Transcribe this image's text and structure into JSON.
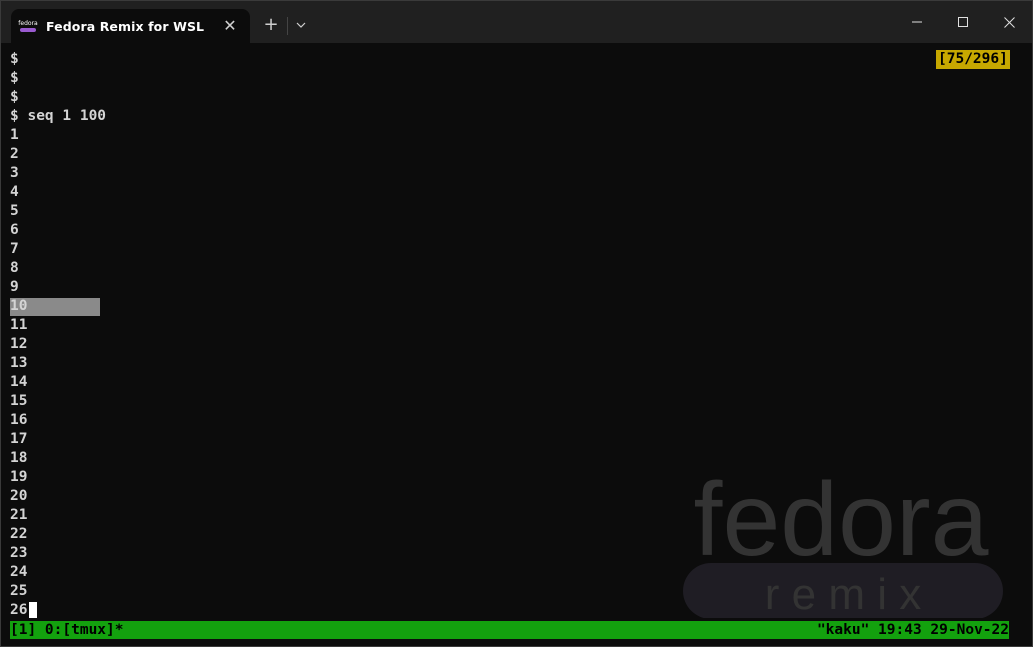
{
  "window": {
    "tab_title": "Fedora Remix for WSL",
    "tab_icon_text": "fedora",
    "new_tab_symbol": "+",
    "close_tab_symbol": "✕"
  },
  "terminal": {
    "lines": [
      "$",
      "$",
      "$",
      "$ seq 1 100",
      "1",
      "2",
      "3",
      "4",
      "5",
      "6",
      "7",
      "8",
      "9",
      "10",
      "11",
      "12",
      "13",
      "14",
      "15",
      "16",
      "17",
      "18",
      "19",
      "20",
      "21",
      "22",
      "23",
      "24",
      "25",
      "26"
    ],
    "highlighted_line": "10",
    "position_indicator": "[75/296]"
  },
  "watermark": {
    "brand_text": "fedora",
    "sub_text": "r e m i x"
  },
  "statusbar": {
    "left": "[1] 0:[tmux]*",
    "right": "\"kaku\" 19:43 29-Nov-22"
  },
  "colors": {
    "terminal_bg": "#0c0c0c",
    "status_bg": "#13a10e",
    "indicator_bg": "#c7a800",
    "selection_bg": "#8a8a8a"
  }
}
